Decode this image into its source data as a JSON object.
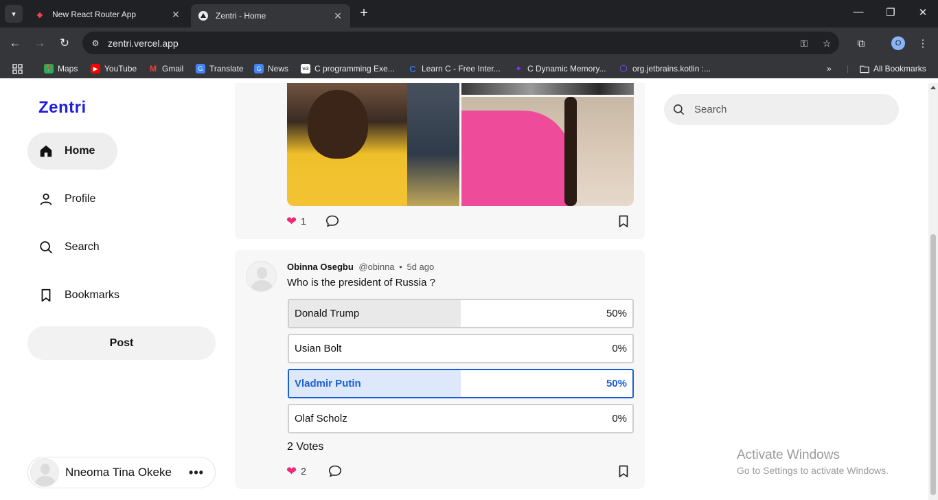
{
  "browser": {
    "tabs": [
      {
        "title": "New React Router App",
        "active": false
      },
      {
        "title": "Zentri - Home",
        "active": true
      }
    ],
    "url": "zentri.vercel.app",
    "profile_initial": "O",
    "bookmarks": [
      {
        "label": "Maps",
        "color": "#34a853"
      },
      {
        "label": "YouTube",
        "color": "#ff0000"
      },
      {
        "label": "Gmail",
        "color": "#ea4335"
      },
      {
        "label": "Translate",
        "color": "#4285f4"
      },
      {
        "label": "News",
        "color": "#4285f4"
      },
      {
        "label": "C programming Exe...",
        "color": "#ffffff"
      },
      {
        "label": "Learn C - Free Inter...",
        "color": "#3b6fe0"
      },
      {
        "label": "C Dynamic Memory...",
        "color": "#7c3aed"
      },
      {
        "label": "org.jetbrains.kotlin :...",
        "color": "#7f52ff"
      }
    ],
    "all_bookmarks": "All Bookmarks"
  },
  "app": {
    "logo": "Zentri",
    "nav": [
      {
        "label": "Home",
        "icon": "home-icon"
      },
      {
        "label": "Profile",
        "icon": "user-icon"
      },
      {
        "label": "Search",
        "icon": "search-icon"
      },
      {
        "label": "Bookmarks",
        "icon": "bookmark-icon"
      }
    ],
    "post_button": "Post",
    "current_user": "Nneoma Tina Okeke"
  },
  "feed": {
    "post1": {
      "likes": "1"
    },
    "post2": {
      "author": "Obinna Osegbu",
      "handle": "@obinna",
      "separator": "•",
      "time": "5d ago",
      "text": "Who is the president of Russia ?",
      "options": [
        {
          "label": "Donald Trump",
          "percent": "50%",
          "fraction": 0.5,
          "selected": false
        },
        {
          "label": "Usian Bolt",
          "percent": "0%",
          "fraction": 0,
          "selected": false
        },
        {
          "label": "Vladmir Putin",
          "percent": "50%",
          "fraction": 0.5,
          "selected": true
        },
        {
          "label": "Olaf Scholz",
          "percent": "0%",
          "fraction": 0,
          "selected": false
        }
      ],
      "votes": "2 Votes",
      "likes": "2"
    }
  },
  "search": {
    "placeholder": "Search"
  },
  "watermark": {
    "line1": "Activate Windows",
    "line2": "Go to Settings to activate Windows."
  },
  "colors": {
    "accent": "#1d1de0",
    "poll_selected": "#1a5fd1",
    "like": "#f0287a"
  }
}
